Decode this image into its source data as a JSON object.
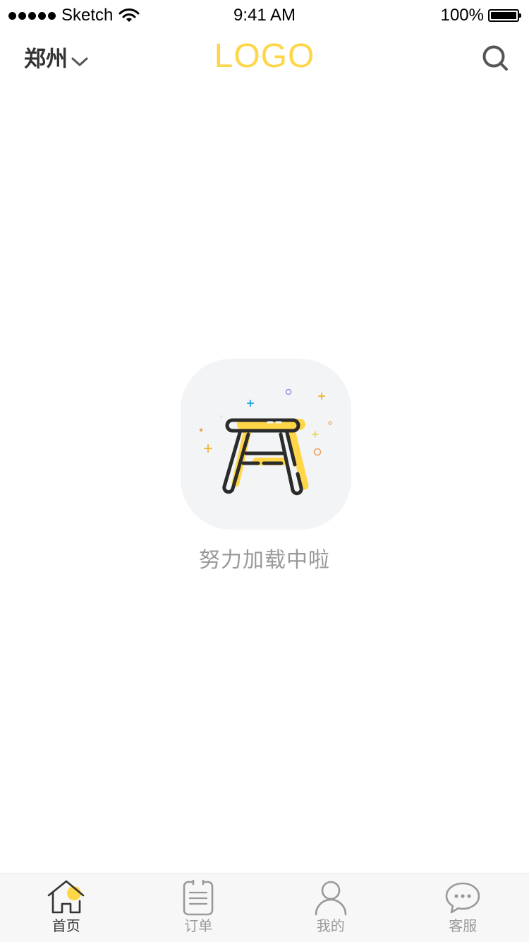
{
  "status_bar": {
    "carrier": "Sketch",
    "time": "9:41 AM",
    "battery": "100%",
    "battery_level": 1.0,
    "icons": [
      "signal-dots-icon",
      "wifi-icon",
      "battery-icon"
    ]
  },
  "nav": {
    "city": "郑州",
    "logo": "LOGO",
    "icons": [
      "chevron-down-icon",
      "search-icon"
    ]
  },
  "loading": {
    "text": "努力加载中啦",
    "icon": "stool-illustration-icon"
  },
  "tabs": [
    {
      "label": "首页",
      "icon": "home-icon",
      "active": true
    },
    {
      "label": "订单",
      "icon": "order-list-icon",
      "active": false
    },
    {
      "label": "我的",
      "icon": "profile-icon",
      "active": false
    },
    {
      "label": "客服",
      "icon": "chat-bubble-icon",
      "active": false
    }
  ],
  "colors": {
    "accent": "#FFD648",
    "text_dark": "#333333",
    "text_muted": "#999999",
    "card_bg": "#F3F4F6",
    "tabbar_bg": "#F7F7F7"
  }
}
